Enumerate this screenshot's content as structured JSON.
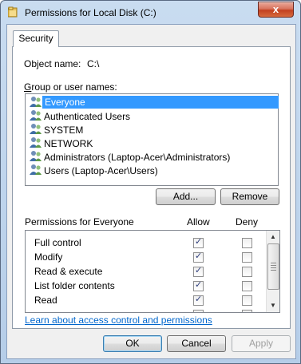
{
  "window": {
    "title": "Permissions for Local Disk (C:)",
    "close_glyph": "x"
  },
  "tabs": [
    {
      "label": "Security"
    }
  ],
  "object": {
    "label": "Object name:",
    "value": "C:\\"
  },
  "groups": {
    "label": "Group or user names:",
    "items": [
      {
        "label": "Everyone",
        "icon": "users-icon",
        "selected": true
      },
      {
        "label": "Authenticated Users",
        "icon": "users-icon"
      },
      {
        "label": "SYSTEM",
        "icon": "users-icon"
      },
      {
        "label": "NETWORK",
        "icon": "users-icon"
      },
      {
        "label": "Administrators (Laptop-Acer\\Administrators)",
        "icon": "users-icon"
      },
      {
        "label": "Users (Laptop-Acer\\Users)",
        "icon": "users-icon"
      }
    ]
  },
  "buttons": {
    "add": "Add...",
    "remove": "Remove",
    "ok": "OK",
    "cancel": "Cancel",
    "apply": "Apply"
  },
  "permissions": {
    "label": "Permissions for Everyone",
    "allow_header": "Allow",
    "deny_header": "Deny",
    "rows": [
      {
        "name": "Full control",
        "allow": true,
        "deny": false
      },
      {
        "name": "Modify",
        "allow": true,
        "deny": false
      },
      {
        "name": "Read & execute",
        "allow": true,
        "deny": false
      },
      {
        "name": "List folder contents",
        "allow": true,
        "deny": false
      },
      {
        "name": "Read",
        "allow": true,
        "deny": false
      }
    ]
  },
  "link": "Learn about access control and permissions",
  "colors": {
    "selection": "#3399ff",
    "link": "#0066cc",
    "close_button": "#c2401f"
  }
}
